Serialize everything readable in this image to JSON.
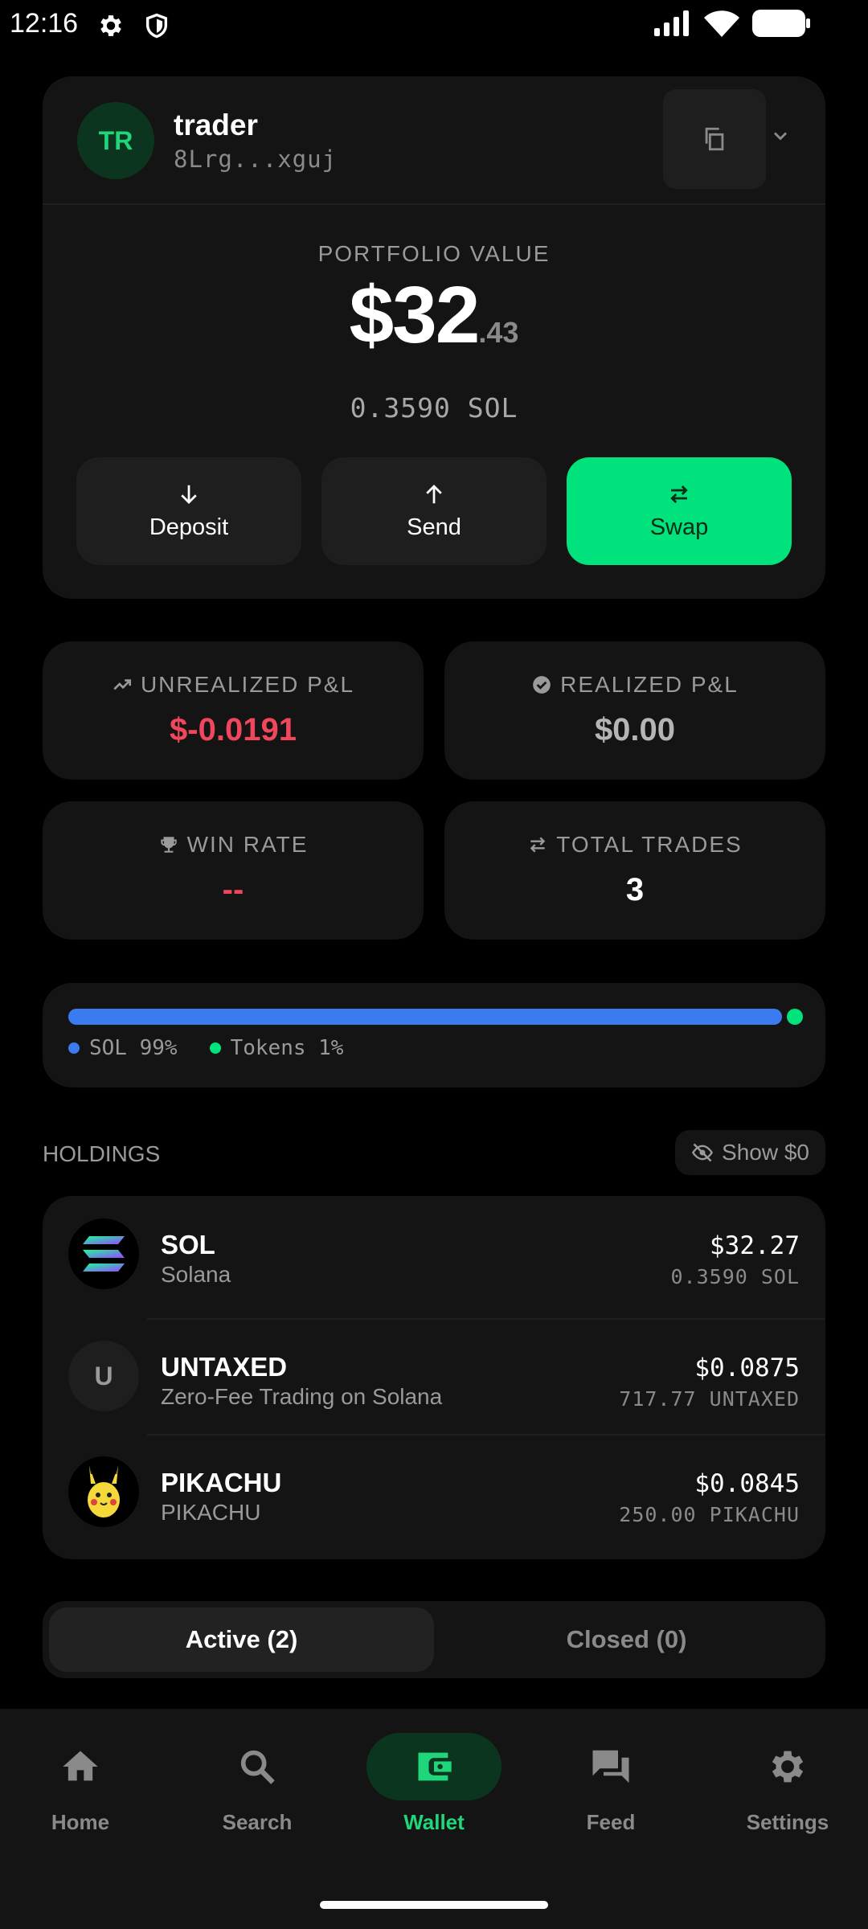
{
  "status_bar": {
    "time": "12:16"
  },
  "account": {
    "avatar_initials": "TR",
    "name": "trader",
    "address": "8Lrg...xguj",
    "portfolio_label": "PORTFOLIO VALUE",
    "portfolio_int": "$32",
    "portfolio_dec": ".43",
    "portfolio_sol": "0.3590 SOL",
    "actions": {
      "deposit": "Deposit",
      "send": "Send",
      "swap": "Swap"
    }
  },
  "stats": {
    "unrealized": {
      "label": "UNREALIZED P&L",
      "value": "$-0.0191",
      "color": "#f0475c"
    },
    "realized": {
      "label": "REALIZED P&L",
      "value": "$0.00",
      "color": "#b5b5b5"
    },
    "win_rate": {
      "label": "WIN RATE",
      "value": "--",
      "color": "#f0475c"
    },
    "total_trades": {
      "label": "TOTAL TRADES",
      "value": "3",
      "color": "#ffffff"
    }
  },
  "allocation": {
    "sol_fraction": 0.99,
    "tokens_fraction": 0.01,
    "sol_label": "SOL 99%",
    "tokens_label": "Tokens 1%",
    "sol_color": "#3b7bf0",
    "tokens_color": "#00e27b"
  },
  "holdings": {
    "title": "HOLDINGS",
    "show_zero_label": "Show $0",
    "items": [
      {
        "name": "SOL",
        "subtitle": "Solana",
        "usd": "$32.27",
        "amount": "0.3590 SOL",
        "icon": "solana-logo-icon"
      },
      {
        "name": "UNTAXED",
        "subtitle": "Zero-Fee Trading on Solana",
        "usd": "$0.0875",
        "amount": "717.77 UNTAXED",
        "icon": "letter-icon",
        "icon_letter": "U"
      },
      {
        "name": "PIKACHU",
        "subtitle": "PIKACHU",
        "usd": "$0.0845",
        "amount": "250.00 PIKACHU",
        "icon": "pikachu-icon"
      }
    ]
  },
  "positions_tabs": {
    "active": "Active (2)",
    "closed": "Closed (0)"
  },
  "bottom_nav": {
    "home": "Home",
    "search": "Search",
    "wallet": "Wallet",
    "feed": "Feed",
    "settings": "Settings",
    "active": "Wallet",
    "active_color": "#1fd67a"
  }
}
